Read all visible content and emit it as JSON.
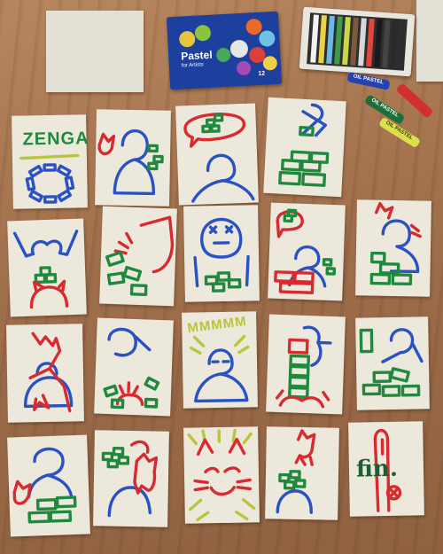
{
  "scene": {
    "pastel_box_brand": "Pastel",
    "pastel_box_subtitle": "for Artists",
    "pastel_box_count": "12",
    "crayon_label_1": "OIL PASTEL",
    "crayon_label_2": "OIL PASTEL",
    "crayon_label_3": "OIL PASTEL",
    "card_title": "ZENGA",
    "card_hum": "MMMMM",
    "card_end": "fin."
  },
  "colors": {
    "floor": "#a4744f",
    "paper": "#ece9dc",
    "blue": "#2a52c2",
    "red": "#d82a2f",
    "green": "#1f8a3e",
    "yellow_green": "#b9c53a"
  }
}
